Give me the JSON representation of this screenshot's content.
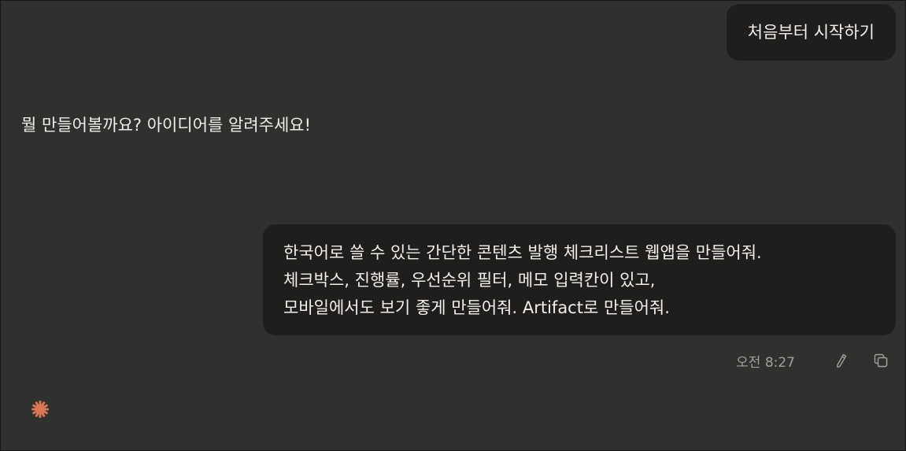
{
  "messages": {
    "user_first": "처음부터 시작하기",
    "assistant_prompt": "뭘 만들어볼까요? 아이디어를 알려주세요!",
    "user_request_lines": [
      "한국어로 쓸 수 있는 간단한 콘텐츠 발행 체크리스트 웹앱을 만들어줘.",
      "체크박스, 진행률, 우선순위 필터, 메모 입력칸이 있고,",
      "모바일에서도 보기 좋게 만들어줘. Artifact로 만들어줘."
    ]
  },
  "meta": {
    "timestamp": "오전 8:27",
    "edit_icon": "pencil-icon",
    "copy_icon": "copy-icon"
  },
  "status": {
    "icon": "spark-icon",
    "color": "#d97757"
  },
  "colors": {
    "background": "#30302e",
    "bubble": "#1f1e1d",
    "text": "#f0eee6",
    "muted": "#a3a199"
  }
}
